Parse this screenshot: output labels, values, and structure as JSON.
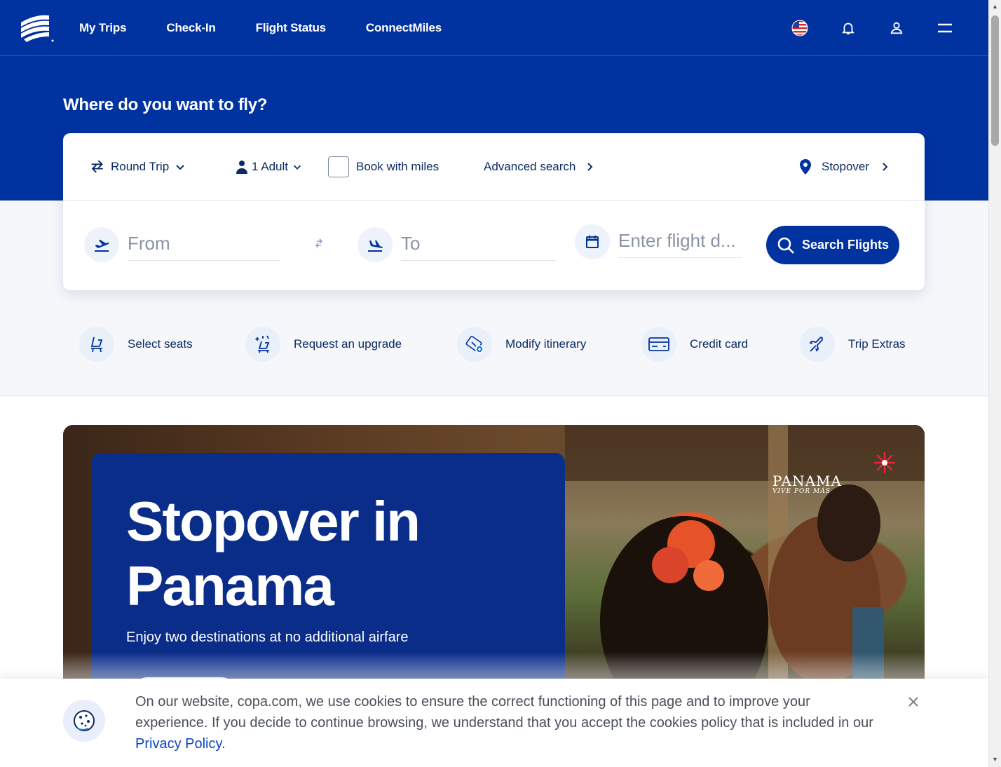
{
  "nav": {
    "links": [
      "My Trips",
      "Check-In",
      "Flight Status",
      "ConnectMiles"
    ]
  },
  "hero": {
    "title": "Where do you want to fly?"
  },
  "search": {
    "trip_type": "Round Trip",
    "passengers": "1 Adult",
    "book_with_miles": "Book with miles",
    "advanced_search": "Advanced search",
    "stopover": "Stopover",
    "from_placeholder": "From",
    "to_placeholder": "To",
    "date_placeholder": "Enter flight d...",
    "search_button": "Search Flights"
  },
  "quick_links": [
    "Select seats",
    "Request an upgrade",
    "Modify itinerary",
    "Credit card",
    "Trip Extras"
  ],
  "promo": {
    "title": "Stopover in Panama",
    "subtitle": "Enjoy two destinations at no additional airfare",
    "brand": "PANAMA",
    "brand_tag": "VIVE POR MÁS"
  },
  "cookie": {
    "text": "On our website, copa.com, we use cookies to ensure the correct functioning of this page and to improve your experience. If you decide to continue browsing, we understand that you accept the cookies policy that is included in our ",
    "link": "Privacy Policy",
    "end": "."
  },
  "colors": {
    "brand_blue": "#0032a0",
    "panel_blue": "#0b2d8a",
    "link_blue": "#0b44c5"
  }
}
